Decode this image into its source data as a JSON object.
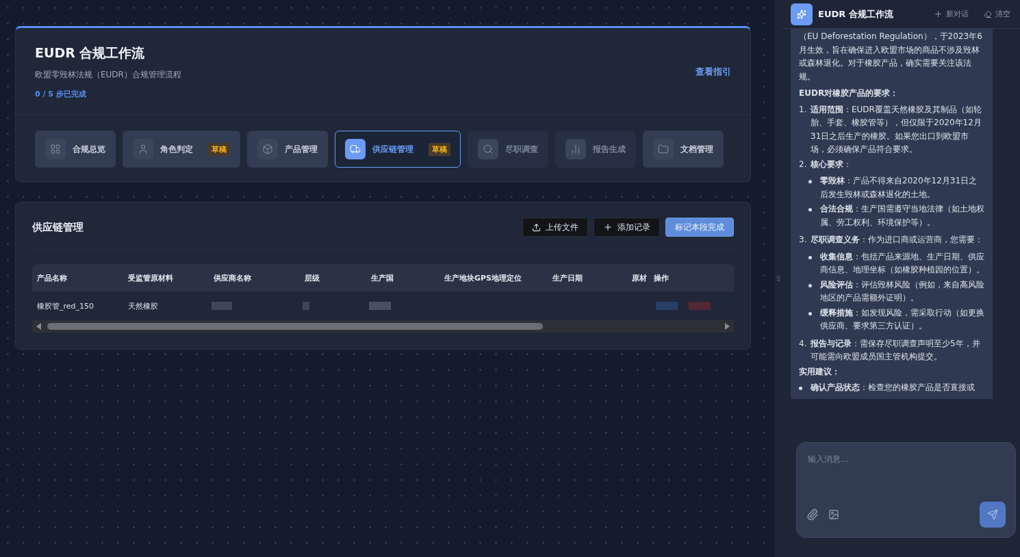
{
  "workflow": {
    "title": "EUDR 合规工作流",
    "subtitle": "欧盟零毁林法规（EUDR）合规管理流程",
    "progress": "0 / 5 步已完成",
    "guide_link": "查看指引",
    "steps": [
      {
        "label": "合规总览",
        "selected": false,
        "disabled": false
      },
      {
        "label": "角色判定",
        "badge": "草稿",
        "selected": false,
        "disabled": false
      },
      {
        "label": "产品管理",
        "selected": false,
        "disabled": false
      },
      {
        "label": "供应链管理",
        "badge": "草稿",
        "selected": true,
        "disabled": false
      },
      {
        "label": "尽职调查",
        "selected": false,
        "disabled": true
      },
      {
        "label": "报告生成",
        "selected": false,
        "disabled": true
      },
      {
        "label": "文档管理",
        "selected": false,
        "disabled": false
      }
    ]
  },
  "section": {
    "title": "供应链管理",
    "buttons": [
      {
        "label": "上传文件",
        "kind": "upload"
      },
      {
        "label": "添加记录",
        "kind": "add"
      },
      {
        "label": "标记本段完成",
        "kind": "primary"
      }
    ],
    "table": {
      "columns": [
        "产品名称",
        "受监管原材料",
        "供应商名称",
        "层级",
        "生产国",
        "生产地块GPS地理定位",
        "生产日期",
        "原材",
        "操作"
      ],
      "rows": [
        [
          "橡胶管_red_150",
          "天然橡胶"
        ]
      ]
    }
  },
  "chat": {
    "title": "EUDR 合规工作流",
    "new_chat": "新对话",
    "clear": "清空",
    "message": [
      {
        "kind": "paragraph",
        "text": "（EU Deforestation Regulation），于2023年6月生效，旨在确保进入欧盟市场的商品不涉及毁林或森林退化。对于橡胶产品，确实需要关注该法规。"
      },
      {
        "kind": "heading",
        "text": "EUDR对橡胶产品的要求："
      },
      {
        "kind": "numbered",
        "number": "1.",
        "text": "**适用范围**：EUDR覆盖天然橡胶及其制品（如轮胎、手套、橡胶管等），但仅限于2020年12月31日之后生产的橡胶。如果您出口到欧盟市场，必须确保产品符合要求。"
      },
      {
        "kind": "numbered",
        "number": "2.",
        "text": "**核心要求**：",
        "children": [
          "**零毁林**：产品不得来自2020年12月31日之后发生毁林或森林退化的土地。",
          "**合法合规**：生产国需遵守当地法律（如土地权属、劳工权利、环境保护等）。"
        ]
      },
      {
        "kind": "numbered",
        "number": "3.",
        "text": "**尽职调查义务**：作为进口商或运营商，您需要：",
        "children": [
          "**收集信息**：包括产品来源地、生产日期、供应商信息、地理坐标（如橡胶种植园的位置）。",
          "**风险评估**：评估毁林风险（例如，来自高风险地区的产品需额外证明）。",
          "**缓释措施**：如发现风险，需采取行动（如更换供应商、要求第三方认证）。"
        ]
      },
      {
        "kind": "numbered",
        "number": "4.",
        "text": "**报告与记录**：需保存尽职调查声明至少5年，并可能需向欧盟成员国主管机构提交。"
      },
      {
        "kind": "heading",
        "text": "实用建议："
      },
      {
        "kind": "bullet",
        "text": "**确认产品状态**：检查您的橡胶产品是否直接或"
      }
    ],
    "input": {
      "placeholder": "输入消息..."
    }
  }
}
